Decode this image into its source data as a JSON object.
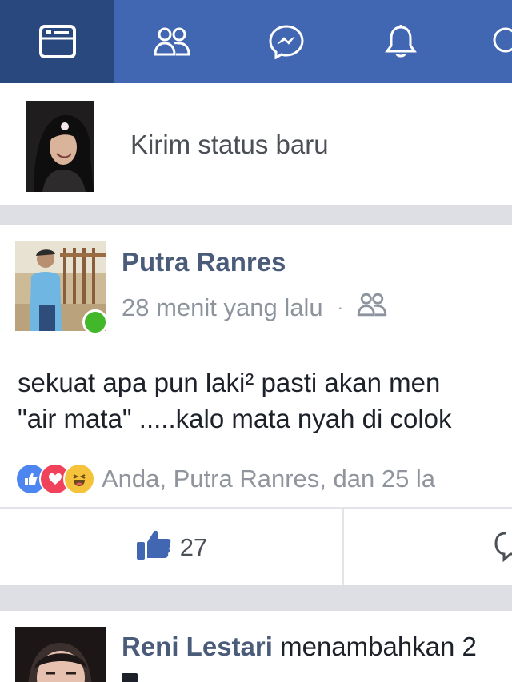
{
  "nav": {
    "tabs": [
      {
        "icon": "news-feed-icon",
        "active": true
      },
      {
        "icon": "friends-icon",
        "active": false
      },
      {
        "icon": "messenger-icon",
        "active": false
      },
      {
        "icon": "notifications-bell-icon",
        "active": false
      },
      {
        "icon": "search-icon",
        "active": false
      }
    ]
  },
  "composer": {
    "prompt": "Kirim status baru"
  },
  "post": {
    "author": "Putra Ranres",
    "time": "28 menit yang lalu",
    "separator": "·",
    "audience_icon": "friends-icon",
    "online": true,
    "text_line1": "sekuat apa pun laki² pasti akan men",
    "text_line2": "\"air mata\" .....kalo mata nyah di colok",
    "reactions": [
      "like",
      "love",
      "haha"
    ],
    "reaction_names": "Anda, Putra Ranres, dan 25 la",
    "like_count": "27"
  },
  "post2": {
    "author": "Reni Lestari",
    "action": "menambahkan 2"
  },
  "colors": {
    "brand": "#4267b2",
    "active_tab": "#29487d",
    "name": "#4b5c7b",
    "online": "#42b72a",
    "like_blue": "#4e86f1",
    "love_red": "#f0425a",
    "haha_yellow": "#f5c33b"
  }
}
